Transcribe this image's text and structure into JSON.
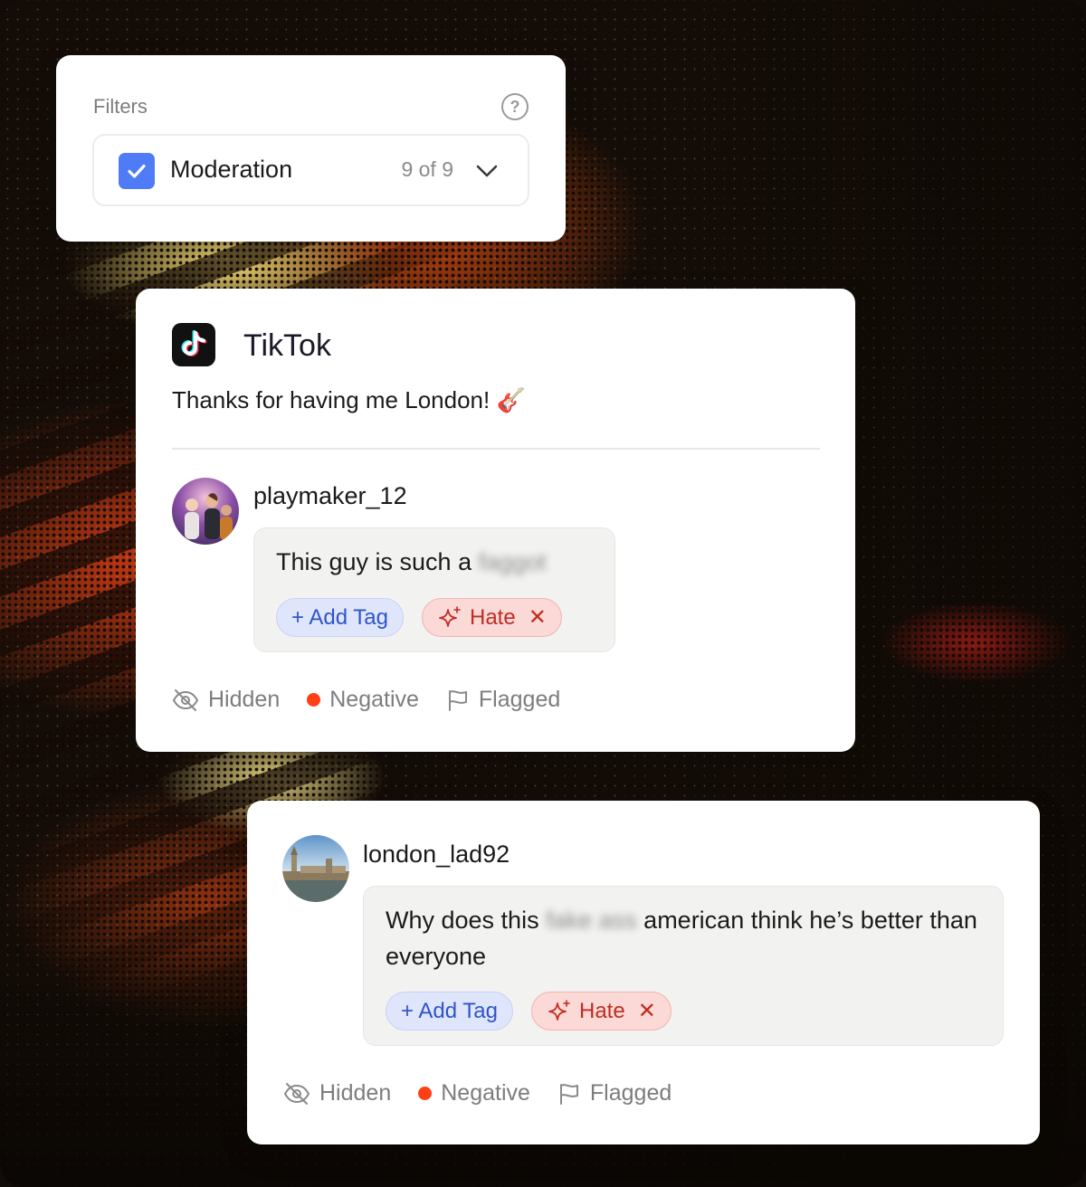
{
  "filters": {
    "label": "Filters",
    "help_icon": "question-circle-icon",
    "selected": {
      "name": "Moderation",
      "checked": true,
      "count": "9 of 9"
    }
  },
  "post": {
    "platform": "TikTok",
    "platform_icon": "tiktok-logo",
    "caption": "Thanks for having me London! 🎸",
    "comment": {
      "username": "playmaker_12",
      "text_before": "This guy is such a",
      "redacted": "faggot",
      "text_after": "",
      "add_tag_label": "+ Add Tag",
      "tag_label": "Hate"
    },
    "status": {
      "visibility": "Hidden",
      "sentiment": "Negative",
      "flag": "Flagged"
    }
  },
  "reply": {
    "username": "london_lad92",
    "text_before": "Why does this",
    "redacted": "fake ass",
    "text_after": "american think he’s better than everyone",
    "add_tag_label": "+ Add Tag",
    "tag_label": "Hate",
    "status": {
      "visibility": "Hidden",
      "sentiment": "Negative",
      "flag": "Flagged"
    }
  },
  "colors": {
    "accent": "#4f7cf6",
    "negative": "#ff4016",
    "hate_tag_bg": "#fbd9d6",
    "add_tag_bg": "#dfe6fb"
  }
}
